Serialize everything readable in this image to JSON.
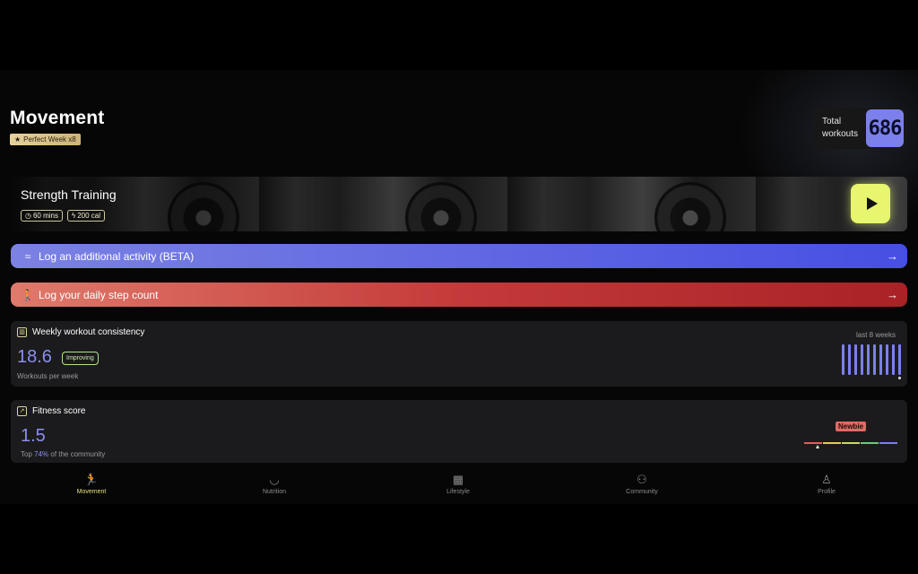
{
  "header": {
    "title": "Movement",
    "badge": "Perfect Week x8",
    "badge_icon": "star-icon"
  },
  "total_workouts": {
    "label": "Total workouts",
    "value": "686"
  },
  "hero": {
    "title": "Strength Training",
    "chips": [
      {
        "icon": "clock-icon",
        "text": "60 mins"
      },
      {
        "icon": "flame-icon",
        "text": "200 cal"
      }
    ],
    "play_icon": "play-icon"
  },
  "actions": {
    "activity_label": "Log an additional activity (BETA)",
    "steps_label": "Log your daily step count",
    "arrow": "→"
  },
  "weekly": {
    "title": "Weekly workout consistency",
    "value": "18.6",
    "status": "Improving",
    "subtitle": "Workouts per week",
    "range_label": "last 8 weeks",
    "bar_levels": [
      1,
      1,
      1,
      1,
      1,
      1,
      1,
      1,
      1,
      1
    ]
  },
  "fitness": {
    "title": "Fitness score",
    "value": "1.5",
    "top_prefix": "Top ",
    "top_percent": "74%",
    "top_suffix": " of the community",
    "level": "Newbie",
    "scale_colors": [
      "#e0605a",
      "#e6c85a",
      "#c7d96a",
      "#6fc97a",
      "#7b80ec"
    ]
  },
  "colors": {
    "accent": "#7b80ec",
    "play": "#e8f56e",
    "active_nav": "#e3e07a"
  },
  "nav": [
    {
      "label": "Movement",
      "icon": "runner-icon",
      "active": true
    },
    {
      "label": "Nutrition",
      "icon": "bowl-icon",
      "active": false
    },
    {
      "label": "Lifestyle",
      "icon": "calendar-icon",
      "active": false
    },
    {
      "label": "Community",
      "icon": "people-icon",
      "active": false
    },
    {
      "label": "Profile",
      "icon": "person-icon",
      "active": false
    }
  ]
}
